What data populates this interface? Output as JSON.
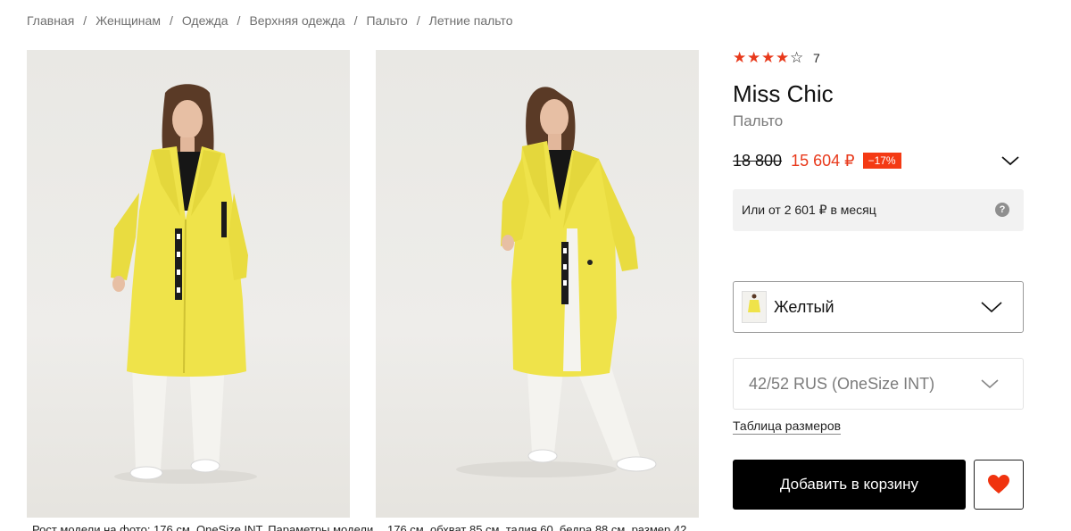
{
  "breadcrumb": {
    "items": [
      "Главная",
      "Женщинам",
      "Одежда",
      "Верхняя одежда",
      "Пальто",
      "Летние пальто"
    ],
    "separator": "/"
  },
  "gallery": {
    "captions": [
      "Рост модели на фото: 176 см, OneSize INT, Параметры модели",
      "176 см, обхват 85 см, талия 60, бедра 88 см, размер 42"
    ]
  },
  "product": {
    "rating": {
      "stars_filled": 4,
      "stars_total": 5,
      "count": "7"
    },
    "brand": "Miss Chic",
    "type": "Пальто",
    "old_price": "18 800",
    "new_price": "15 604 ₽",
    "discount": "−17%",
    "installment": "Или от 2 601 ₽ в месяц",
    "color": {
      "selected": "Желтый",
      "swatch": "#f2e04d"
    },
    "size": {
      "selected": "42/52 RUS (OneSize INT)"
    },
    "size_table_link": "Таблица размеров",
    "add_to_cart": "Добавить в корзину"
  },
  "colors": {
    "accent": "#e8391b",
    "discount_bg": "#f43a14",
    "button_bg": "#000000",
    "coat": "#efe34a",
    "heart": "#f0330f"
  },
  "icons": {
    "help": "question-icon",
    "price_expand": "chevron-down-icon",
    "favorite": "heart-icon"
  }
}
